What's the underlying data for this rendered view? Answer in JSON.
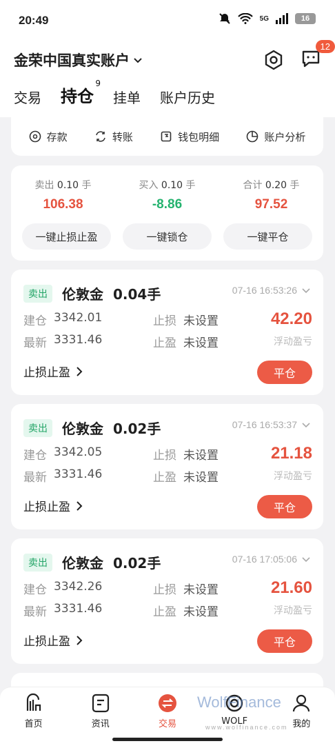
{
  "status_bar": {
    "time": "20:49",
    "network": "5G",
    "battery": "16"
  },
  "header": {
    "account_name": "金荣中国真实账户",
    "message_badge": "12",
    "tabs": [
      {
        "label": "交易"
      },
      {
        "label": "持仓",
        "count": "9"
      },
      {
        "label": "挂单"
      },
      {
        "label": "账户历史"
      }
    ]
  },
  "quick_actions": [
    {
      "label": "存款",
      "icon": "deposit-icon"
    },
    {
      "label": "转账",
      "icon": "transfer-icon"
    },
    {
      "label": "钱包明细",
      "icon": "wallet-icon"
    },
    {
      "label": "账户分析",
      "icon": "pie-chart-icon"
    }
  ],
  "summary": {
    "sell": {
      "label": "卖出",
      "lots": "0.10",
      "unit": "手",
      "value": "106.38"
    },
    "buy": {
      "label": "买入",
      "lots": "0.10",
      "unit": "手",
      "value": "-8.86"
    },
    "total": {
      "label": "合计",
      "lots": "0.20",
      "unit": "手",
      "value": "97.52"
    },
    "buttons": [
      "一键止损止盈",
      "一键锁仓",
      "一键平仓"
    ]
  },
  "positions": [
    {
      "side": "卖出",
      "symbol": "伦敦金",
      "lots": "0.04手",
      "time": "07-16 16:53:26",
      "open_label": "建仓",
      "open_price": "3342.01",
      "latest_label": "最新",
      "latest_price": "3331.46",
      "sl_label": "止损",
      "sl_value": "未设置",
      "tp_label": "止盈",
      "tp_value": "未设置",
      "pnl": "42.20",
      "pnl_label": "浮动盈亏",
      "sltp_link": "止损止盈",
      "close_label": "平仓"
    },
    {
      "side": "卖出",
      "symbol": "伦敦金",
      "lots": "0.02手",
      "time": "07-16 16:53:37",
      "open_label": "建仓",
      "open_price": "3342.05",
      "latest_label": "最新",
      "latest_price": "3331.46",
      "sl_label": "止损",
      "sl_value": "未设置",
      "tp_label": "止盈",
      "tp_value": "未设置",
      "pnl": "21.18",
      "pnl_label": "浮动盈亏",
      "sltp_link": "止损止盈",
      "close_label": "平仓"
    },
    {
      "side": "卖出",
      "symbol": "伦敦金",
      "lots": "0.02手",
      "time": "07-16 17:05:06",
      "open_label": "建仓",
      "open_price": "3342.26",
      "latest_label": "最新",
      "latest_price": "3331.46",
      "sl_label": "止损",
      "sl_value": "未设置",
      "tp_label": "止盈",
      "tp_value": "未设置",
      "pnl": "21.60",
      "pnl_label": "浮动盈亏",
      "sltp_link": "止损止盈",
      "close_label": "平仓"
    }
  ],
  "bottom_nav": [
    {
      "label": "首页",
      "icon": "home-logo-icon"
    },
    {
      "label": "资讯",
      "icon": "news-icon"
    },
    {
      "label": "交易",
      "icon": "trade-icon",
      "active": true
    },
    {
      "label": "WOLF",
      "icon": "wolf-icon"
    },
    {
      "label": "我的",
      "icon": "profile-icon"
    }
  ],
  "watermark": {
    "brand": "WolfFinance",
    "url": "www.wolfinance.com"
  },
  "colors": {
    "accent_red": "#e5533f",
    "profit_green": "#25b36f",
    "close_button": "#ec5b46"
  }
}
